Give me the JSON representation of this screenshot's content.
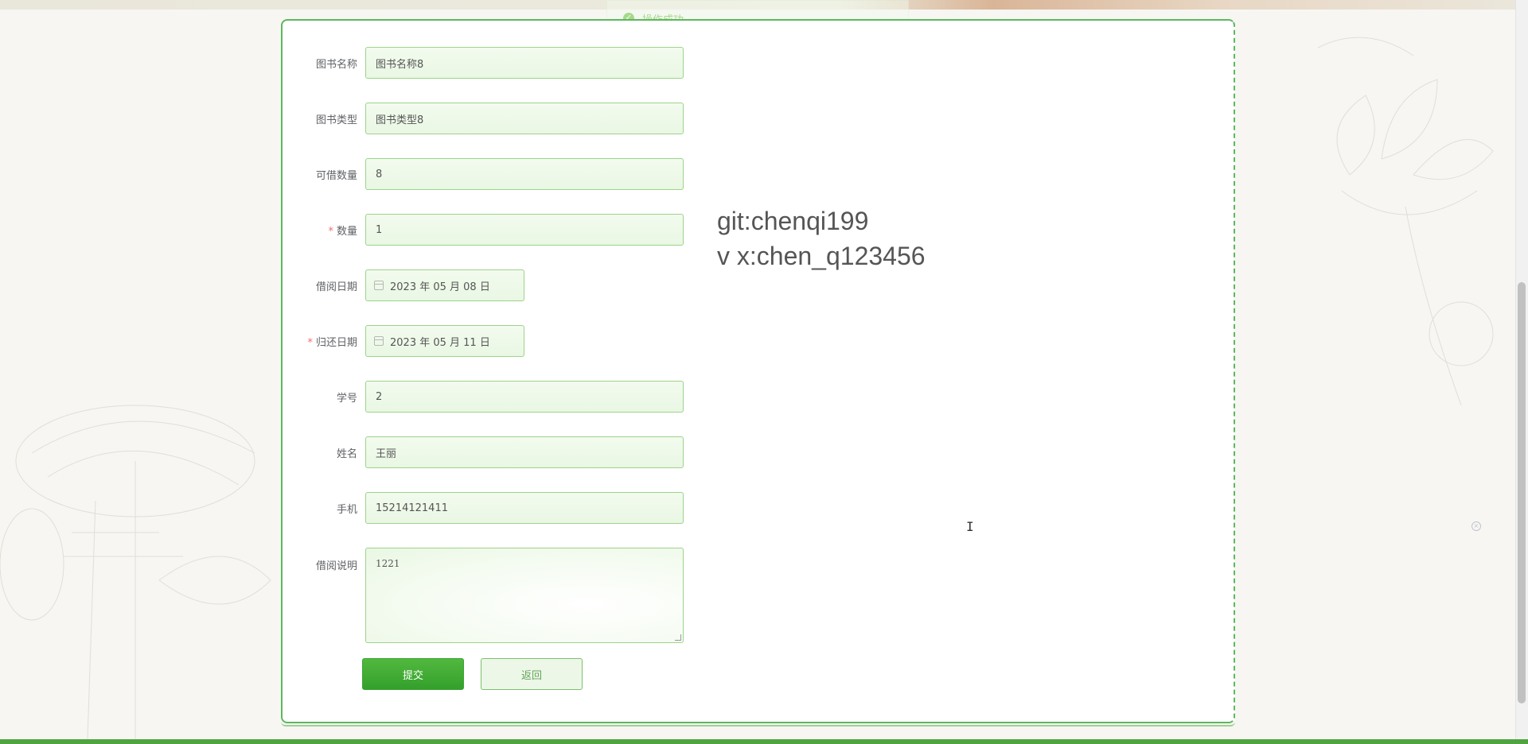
{
  "toast": {
    "message": "操作成功",
    "icon": "check-circle-icon"
  },
  "form": {
    "fields": [
      {
        "label": "图书名称",
        "value": "图书名称8",
        "required": false
      },
      {
        "label": "图书类型",
        "value": "图书类型8",
        "required": false
      },
      {
        "label": "可借数量",
        "value": "8",
        "required": false
      },
      {
        "label": "数量",
        "value": "1",
        "required": true
      },
      {
        "label": "借阅日期",
        "value": "2023 年 05 月 08 日",
        "required": false
      },
      {
        "label": "归还日期",
        "value": "2023 年 05 月 11 日",
        "required": true
      },
      {
        "label": "学号",
        "value": "2",
        "required": false
      },
      {
        "label": "姓名",
        "value": "王丽",
        "required": false
      },
      {
        "label": "手机",
        "value": "15214121411",
        "required": false
      },
      {
        "label": "借阅说明",
        "value": "1221",
        "required": false
      }
    ],
    "required_mark": "*",
    "submit_label": "提交",
    "back_label": "返回"
  },
  "watermark": {
    "line1": "git:chenqi199",
    "line2": "v x:chen_q123456"
  },
  "colors": {
    "accent": "#4fa440",
    "field_border": "#9cd48a",
    "field_bg": "#eaf7e4",
    "required": "#f56c6c"
  }
}
